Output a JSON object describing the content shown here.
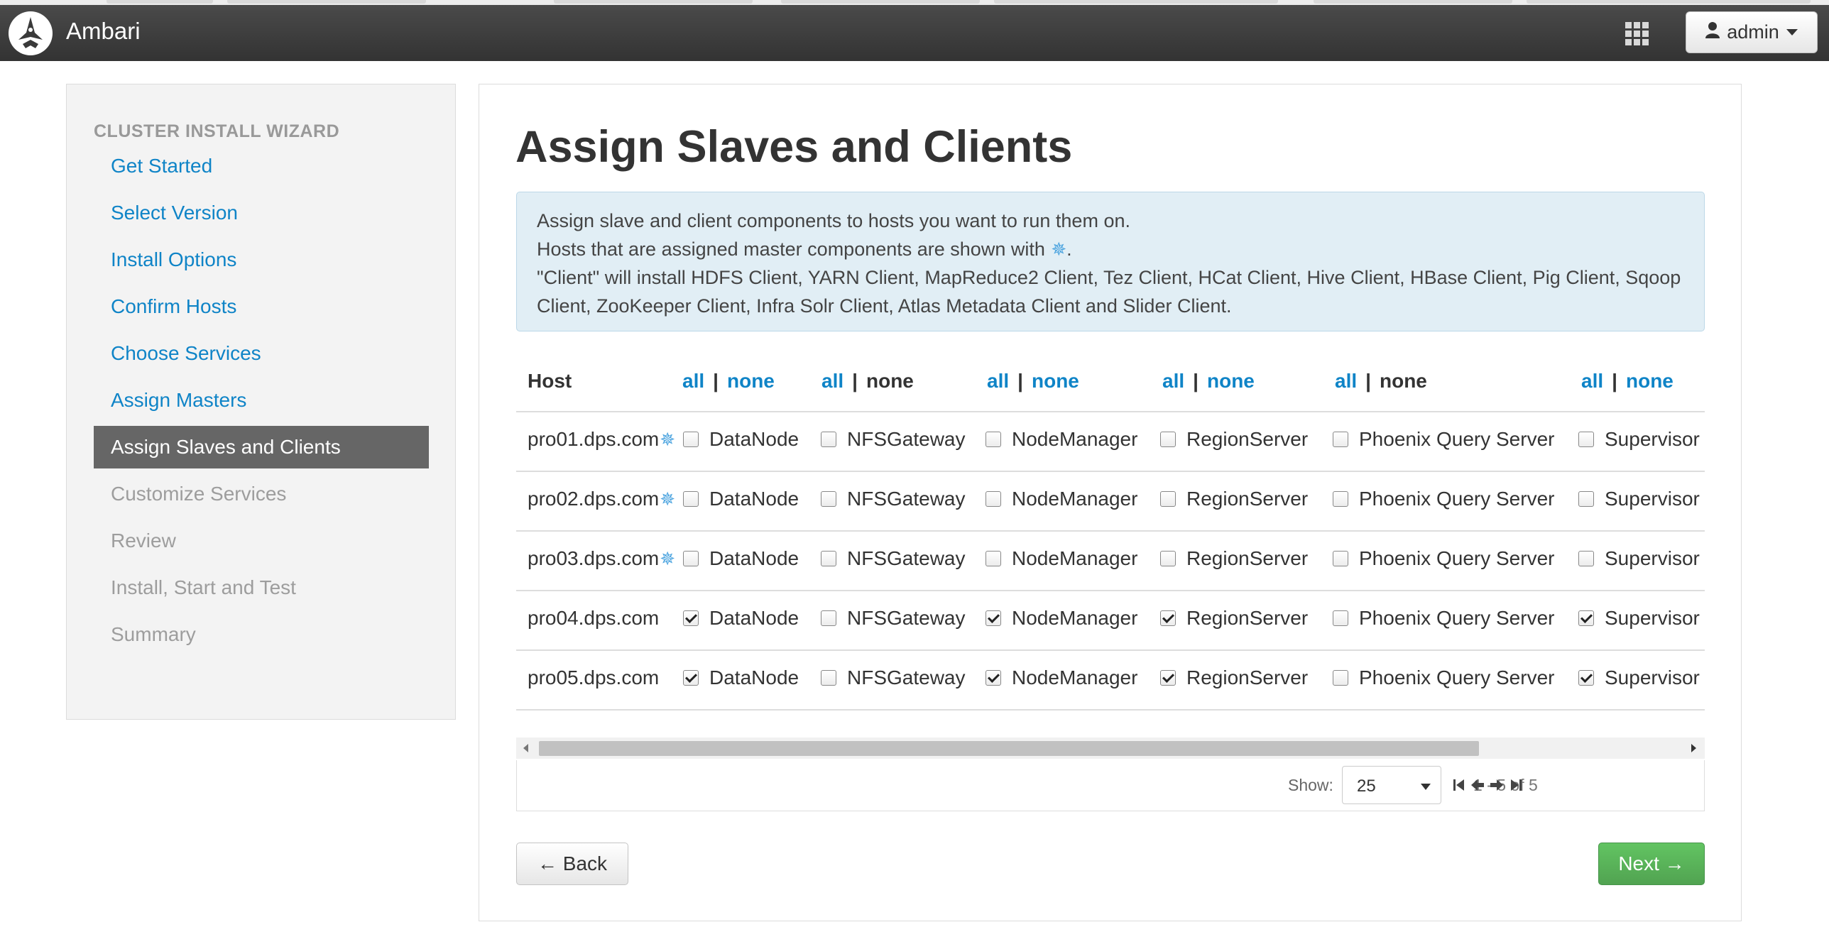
{
  "app": {
    "brand": "Ambari",
    "user_label": "admin"
  },
  "sidebar": {
    "title": "CLUSTER INSTALL WIZARD",
    "steps": [
      {
        "label": "Get Started",
        "state": "done"
      },
      {
        "label": "Select Version",
        "state": "done"
      },
      {
        "label": "Install Options",
        "state": "done"
      },
      {
        "label": "Confirm Hosts",
        "state": "done"
      },
      {
        "label": "Choose Services",
        "state": "done"
      },
      {
        "label": "Assign Masters",
        "state": "done"
      },
      {
        "label": "Assign Slaves and Clients",
        "state": "active"
      },
      {
        "label": "Customize Services",
        "state": "todo"
      },
      {
        "label": "Review",
        "state": "todo"
      },
      {
        "label": "Install, Start and Test",
        "state": "todo"
      },
      {
        "label": "Summary",
        "state": "todo"
      }
    ]
  },
  "main": {
    "title": "Assign Slaves and Clients",
    "info": {
      "line1": "Assign slave and client components to hosts you want to run them on.",
      "line2a": "Hosts that are assigned master components are shown with ",
      "master_symbol": "✵",
      "line2b": ".",
      "line3": "\"Client\" will install HDFS Client, YARN Client, MapReduce2 Client, Tez Client, HCat Client, Hive Client, HBase Client, Pig Client, Sqoop Client, ZooKeeper Client, Infra Solr Client, Atlas Metadata Client and Slider Client."
    }
  },
  "table": {
    "host_header": "Host",
    "select_all": "all",
    "select_none": "none",
    "separator": "|",
    "components": [
      "DataNode",
      "NFSGateway",
      "NodeManager",
      "RegionServer",
      "Phoenix Query Server",
      "Supervisor"
    ],
    "rows": [
      {
        "host": "pro01.dps.com",
        "master": true,
        "checked": [
          false,
          false,
          false,
          false,
          false,
          false
        ]
      },
      {
        "host": "pro02.dps.com",
        "master": true,
        "checked": [
          false,
          false,
          false,
          false,
          false,
          false
        ]
      },
      {
        "host": "pro03.dps.com",
        "master": true,
        "checked": [
          false,
          false,
          false,
          false,
          false,
          false
        ]
      },
      {
        "host": "pro04.dps.com",
        "master": false,
        "checked": [
          true,
          false,
          true,
          true,
          false,
          true
        ]
      },
      {
        "host": "pro05.dps.com",
        "master": false,
        "checked": [
          true,
          false,
          true,
          true,
          false,
          true
        ]
      }
    ]
  },
  "pagination": {
    "show_label": "Show:",
    "page_size": "25",
    "info": "1 - 5 of 5"
  },
  "buttons": {
    "back": "← Back",
    "next": "Next →"
  },
  "colors": {
    "link": "#0f84c7",
    "active_step": "#666666",
    "next_button": "#5bb75b",
    "info_bg": "#e1eef5"
  }
}
